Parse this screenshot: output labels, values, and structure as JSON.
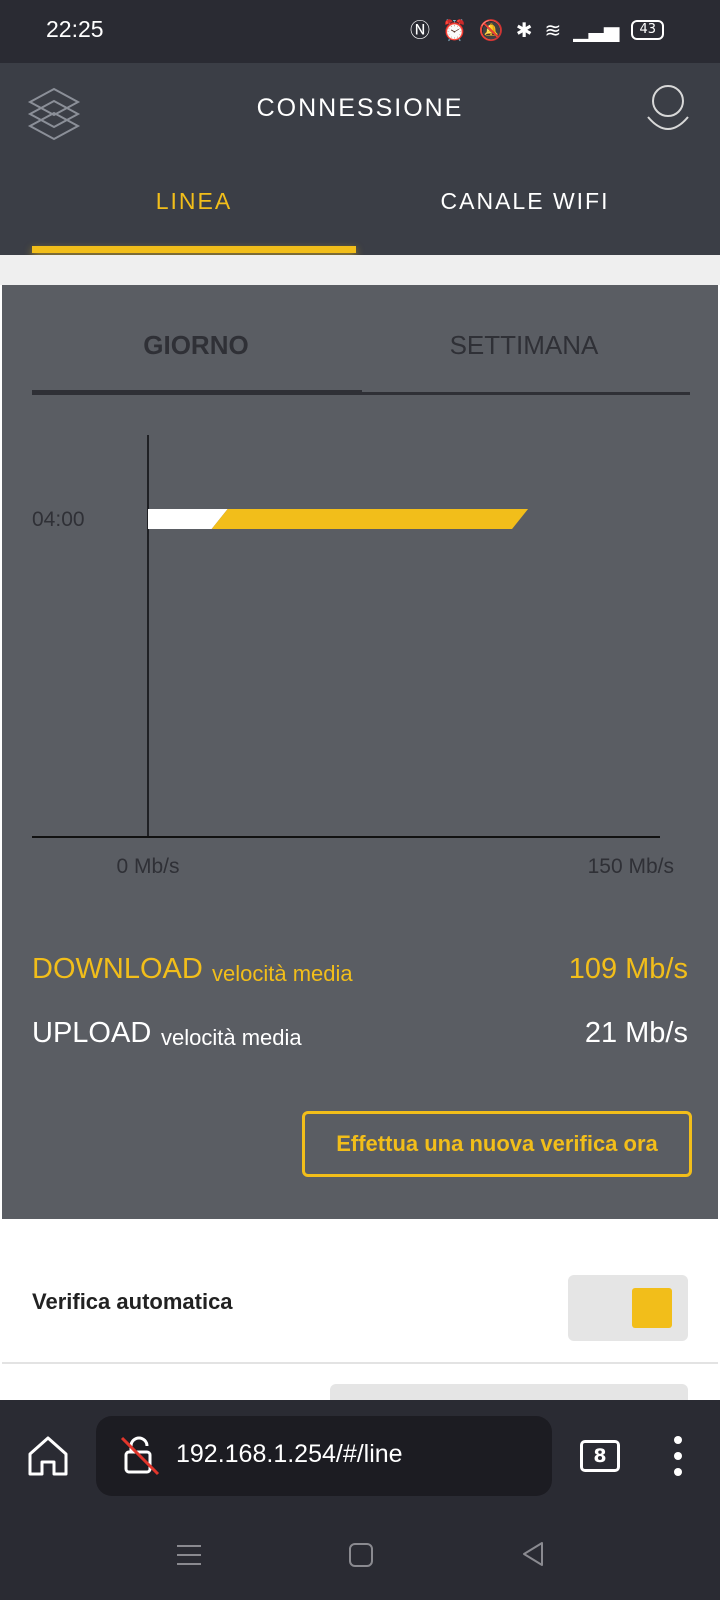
{
  "status_bar": {
    "time": "22:25",
    "icons": [
      "nfc-icon",
      "alarm-icon",
      "mute-icon",
      "bluetooth-icon",
      "wifi-icon",
      "signal-icon"
    ],
    "battery": "43"
  },
  "header": {
    "title": "CONNESSIONE",
    "tabs": [
      {
        "label": "LINEA",
        "active": true
      },
      {
        "label": "CANALE WIFI",
        "active": false
      }
    ]
  },
  "card": {
    "subtabs": [
      {
        "label": "GIORNO",
        "active": true
      },
      {
        "label": "SETTIMANA",
        "active": false
      }
    ],
    "download": {
      "label": "DOWNLOAD",
      "sub": "velocità media",
      "value": "109 Mb/s"
    },
    "upload": {
      "label": "UPLOAD",
      "sub": "velocità media",
      "value": "21 Mb/s"
    },
    "verify_button": "Effettua una nuova verifica ora"
  },
  "chart_data": {
    "type": "bar",
    "orientation": "horizontal",
    "categories": [
      "04:00"
    ],
    "series": [
      {
        "values": [
          21
        ],
        "color": "#ffffff"
      },
      {
        "values": [
          109
        ],
        "color": "#f2be1a"
      }
    ],
    "xlim": [
      0,
      150
    ],
    "xtick_labels": [
      "0 Mb/s",
      "150 Mb/s"
    ]
  },
  "auto_verify": {
    "label": "Verifica automatica",
    "enabled": true
  },
  "browser": {
    "url": "192.168.1.254/#/line",
    "tab_count": "8"
  },
  "colors": {
    "accent": "#f2be1a",
    "header_bg": "#3b3e46",
    "card_bg": "#5a5d63"
  }
}
